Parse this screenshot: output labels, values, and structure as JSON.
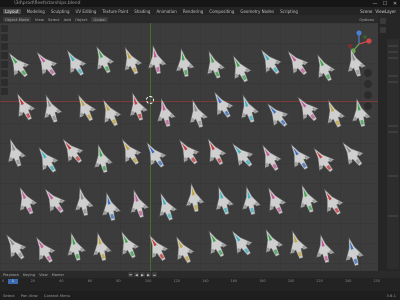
{
  "window": {
    "title": "\\3d\\prod\\fleet\\starships.blend",
    "controls": [
      "—",
      "☐",
      "✕"
    ]
  },
  "menubar": {
    "items": [
      "Layout",
      "Modeling",
      "Sculpting",
      "UV Editing",
      "Texture Paint",
      "Shading",
      "Animation",
      "Rendering",
      "Compositing",
      "Geometry Nodes",
      "Scripting"
    ],
    "active_index": 0,
    "scene_label": "Scene",
    "view_layer_label": "ViewLayer"
  },
  "header": {
    "mode": "Object Mode",
    "menus": [
      "View",
      "Select",
      "Add",
      "Object"
    ],
    "transform": "Global",
    "options": "Options"
  },
  "timeline": {
    "menus": [
      "Playback",
      "Keying",
      "View",
      "Marker"
    ],
    "play_icons": [
      "⏮",
      "◀",
      "▶",
      "▶",
      "⏭"
    ],
    "current_frame": "1",
    "ruler": [
      "0",
      "20",
      "40",
      "60",
      "80",
      "100",
      "120",
      "140",
      "160",
      "180",
      "200",
      "220",
      "240",
      "250"
    ]
  },
  "statusbar": {
    "hints": [
      "Select",
      "Pan View",
      "Context Menu"
    ],
    "version": "3.6.1"
  },
  "viewport": {
    "ship_colors": [
      "#c23b3b",
      "#3fa34d",
      "#3b6fc2",
      "#c2a23b",
      "#8e8e8e",
      "#3bb0c2",
      "#c25a9a"
    ]
  }
}
